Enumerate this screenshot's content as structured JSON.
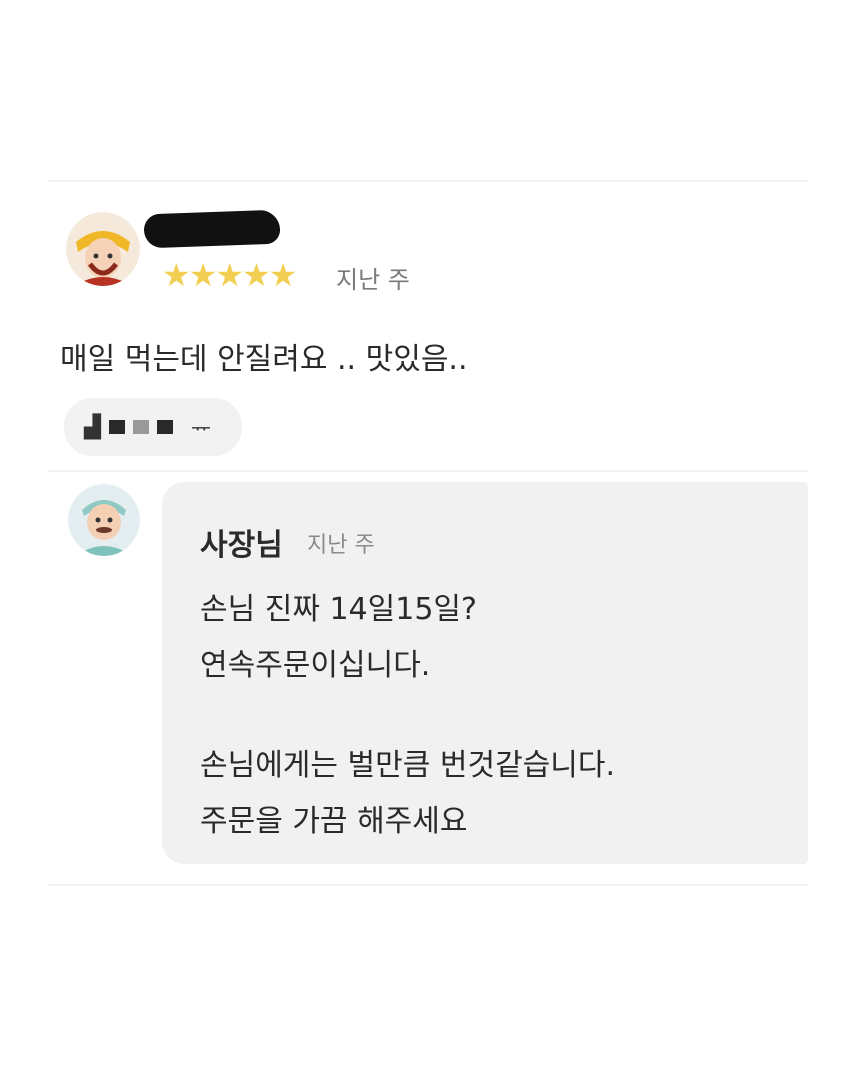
{
  "review": {
    "reviewer_name": "",
    "rating_stars": "★★★★★",
    "rating_value": 5,
    "date": "지난 주",
    "text": "매일 먹는데 안질려요 .. 맛있음.."
  },
  "menu_chip": {
    "glyph_left": "▟",
    "glyph_right": "ᅲ"
  },
  "reply": {
    "owner_name": "사장님",
    "date": "지난 주",
    "lines": [
      "손님 진짜 14일15일?",
      "연속주문이십니다.",
      "",
      "손님에게는 벌만큼 번것같습니다.",
      "주문을 가끔 해주세요"
    ]
  },
  "icons": {
    "reviewer_avatar": "cartoon-character-avatar-icon",
    "owner_avatar": "cartoon-owner-avatar-icon"
  },
  "colors": {
    "star": "#f2cf52",
    "bubble": "#f1f1f1"
  }
}
